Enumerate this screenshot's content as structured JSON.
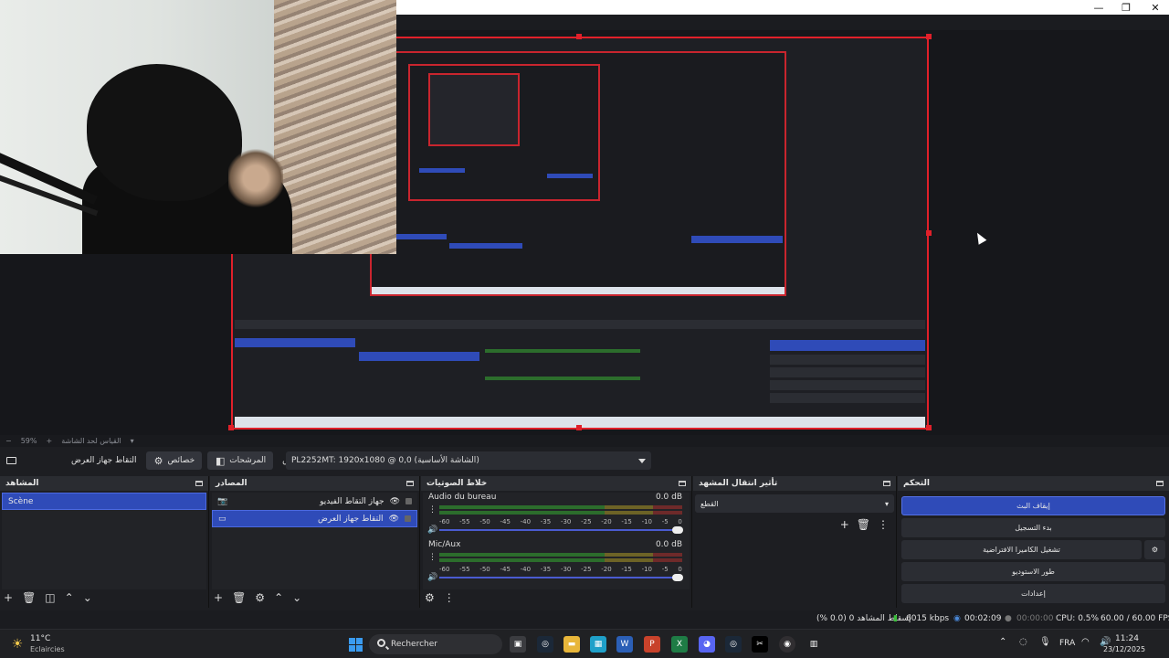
{
  "window": {
    "controls": [
      "—",
      "❐",
      "✕"
    ]
  },
  "preview": {
    "zoom_label": "59%",
    "zoom_hint": "القياس لحد الشاشة"
  },
  "context_bar": {
    "source_label": "التقاط جهاز العرض",
    "properties_label": "خصائص",
    "filters_label": "المرشحات",
    "display_label": "جهاز العرض",
    "display_value": "PL2252MT: 1920x1080 @ 0,0 (الشاشة الأساسية)"
  },
  "docks": {
    "scenes": {
      "title": "المشاهد",
      "items": [
        {
          "name": "Scène"
        }
      ]
    },
    "sources": {
      "title": "المصادر",
      "items": [
        {
          "name": "جهاز التقاط الفيديو"
        },
        {
          "name": "التقاط جهاز العرض"
        }
      ]
    },
    "mixer": {
      "title": "خلاط الصوتيات",
      "channels": [
        {
          "name": "Audio du bureau",
          "db": "0.0 dB"
        },
        {
          "name": "Mic/Aux",
          "db": "0.0 dB"
        }
      ],
      "ticks": [
        "-60",
        "-55",
        "-50",
        "-45",
        "-40",
        "-35",
        "-30",
        "-25",
        "-20",
        "-15",
        "-10",
        "-5",
        "0"
      ]
    },
    "transitions": {
      "title": "تأثير انتقال المشهد",
      "value": "القطع"
    },
    "controls": {
      "title": "التحكم",
      "buttons": [
        "إيقاف البث",
        "بدء التسجيل",
        "تشغيل الكاميرا الافتراضية",
        "طور الاستوديو",
        "إعدادات"
      ]
    }
  },
  "status": {
    "dropped": "إسقاط المشاهد 0 (0.0 %)",
    "bitrate": "6015 kbps",
    "stream_time": "00:02:09",
    "rec_time": "00:00:00",
    "cpu": "CPU: 0.5%",
    "fps": "60.00 / 60.00 FPS"
  },
  "taskbar": {
    "weather_temp": "11°C",
    "weather_desc": "Eclaircies",
    "search_placeholder": "Rechercher",
    "language": "FRA",
    "time": "11:24",
    "date": "23/12/2025"
  },
  "colors": {
    "accent": "#2f4bb8",
    "selection_border": "#e0202a",
    "panel": "#1d1e22"
  }
}
